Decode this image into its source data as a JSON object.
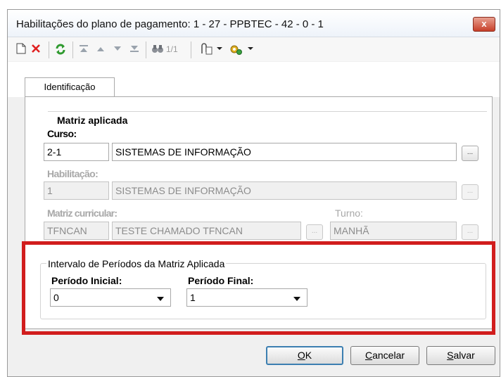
{
  "window": {
    "title": "Habilitações do plano de pagamento: 1 - 27 - PPBTEC - 42 - 0 - 1",
    "close_label": "x"
  },
  "toolbar": {
    "record_counter": "1/1"
  },
  "tabs": [
    {
      "label": "Identificação"
    }
  ],
  "matriz": {
    "group_title": "Matriz aplicada",
    "curso": {
      "label": "Curso:",
      "code": "2-1",
      "name": "SISTEMAS DE INFORMAÇÃO"
    },
    "habilitacao": {
      "label": "Habilitação:",
      "code": "1",
      "name": "SISTEMAS DE INFORMAÇÃO"
    },
    "matriz_curricular": {
      "label": "Matriz curricular:",
      "code": "TFNCAN",
      "name": "TESTE CHAMADO TFNCAN"
    },
    "turno": {
      "label": "Turno:",
      "value": "MANHÃ"
    },
    "browse_label": "..."
  },
  "intervalo": {
    "group_title": "Intervalo de Períodos da Matriz Aplicada",
    "periodo_inicial": {
      "label": "Período Inicial:",
      "value": "0"
    },
    "periodo_final": {
      "label": "Período Final:",
      "value": "1"
    }
  },
  "buttons": {
    "ok": {
      "first": "O",
      "rest": "K"
    },
    "cancelar": {
      "first": "C",
      "rest": "ancelar"
    },
    "salvar": {
      "first": "S",
      "rest": "alvar"
    }
  },
  "colors": {
    "highlight": "#d11d1d",
    "toolbar_delete": "#e02020",
    "toolbar_refresh": "#2f9a2f"
  }
}
